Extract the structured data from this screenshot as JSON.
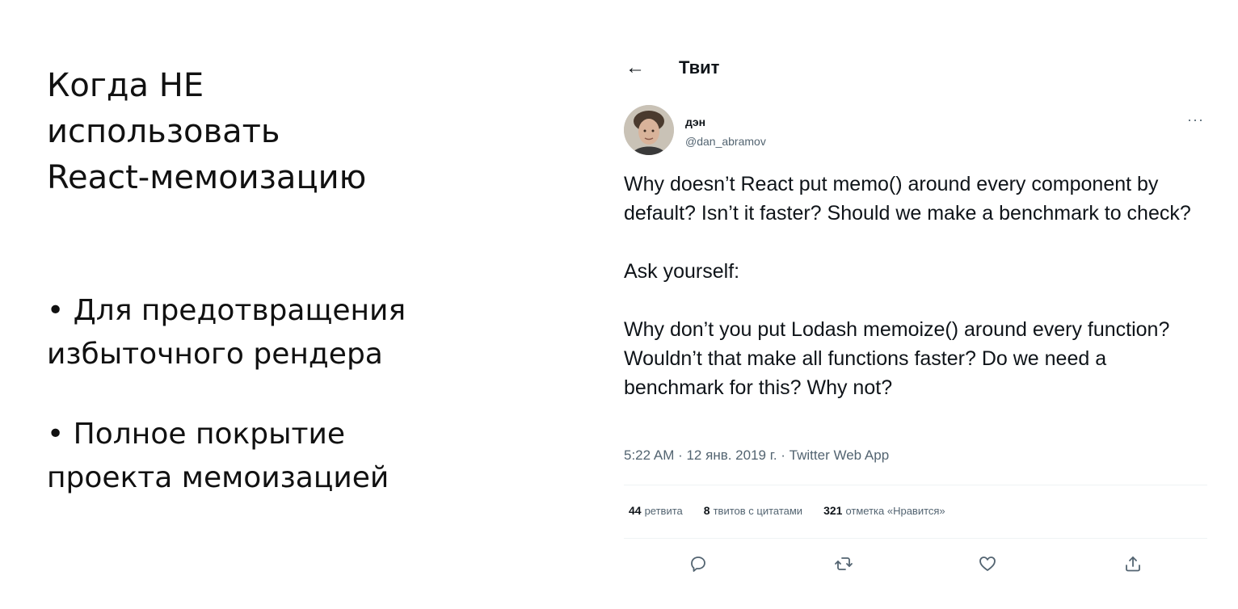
{
  "slide": {
    "title_lines": [
      "Когда НЕ",
      "использовать",
      "React-мемоизацию"
    ],
    "bullets": [
      {
        "lines": [
          "• Для предотвращения",
          "избыточного рендера"
        ]
      },
      {
        "lines": [
          "• Полное покрытие",
          "проекта мемоизацией"
        ]
      }
    ]
  },
  "tweet": {
    "header_title": "Твит",
    "author": {
      "display_name": "дэн",
      "handle": "@dan_abramov"
    },
    "text_paragraphs": [
      "Why doesn’t React put memo() around every component by default? Isn’t it faster? Should we make a benchmark to check?",
      "Ask yourself:",
      "Why don’t you put Lodash memoize() around every function? Wouldn’t that make all functions faster? Do we need a benchmark for this? Why not?"
    ],
    "meta": "5:22 AM · 12 янв. 2019 г. · Twitter Web App",
    "stats": [
      {
        "count": "44",
        "label": "ретвита"
      },
      {
        "count": "8",
        "label": "твитов с цитатами"
      },
      {
        "count": "321",
        "label": "отметка «Нравится»"
      }
    ],
    "icons": {
      "back": "back-arrow-icon",
      "more": "more-icon",
      "reply": "reply-icon",
      "retweet": "retweet-icon",
      "like": "like-icon",
      "share": "share-icon"
    },
    "colors": {
      "text": "#0f1419",
      "secondary": "#536471",
      "separator": "#eff3f4"
    }
  }
}
